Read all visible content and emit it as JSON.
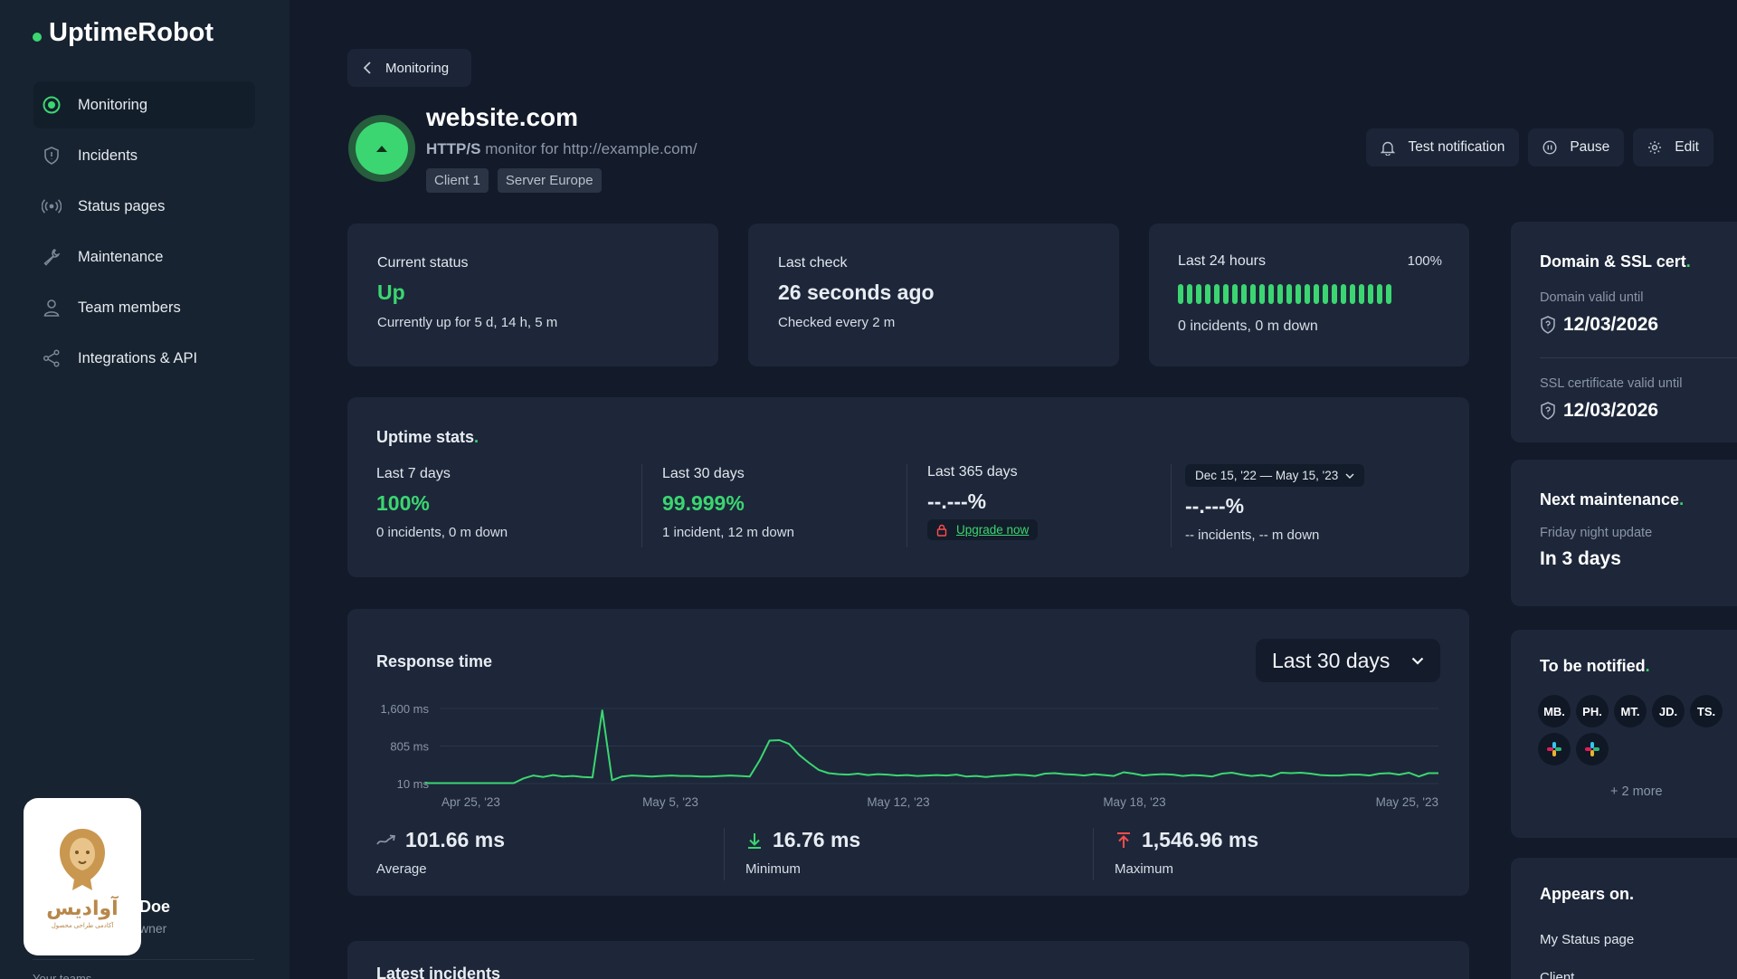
{
  "brand": "UptimeRobot",
  "sidebar": {
    "items": [
      {
        "label": "Monitoring"
      },
      {
        "label": "Incidents"
      },
      {
        "label": "Status pages"
      },
      {
        "label": "Maintenance"
      },
      {
        "label": "Team members"
      },
      {
        "label": "Integrations & API"
      }
    ],
    "user_name": "Doe",
    "user_role": "wner",
    "more": "Your teams",
    "badge_brand": "آوادیس",
    "badge_tag": "آکادمی طراحی محصول"
  },
  "back_label": "Monitoring",
  "monitor": {
    "title": "website.com",
    "type": "HTTP/S",
    "subtitle": "monitor for http://example.com/",
    "tags": [
      "Client 1",
      "Server Europe"
    ]
  },
  "actions": {
    "test": "Test notification",
    "pause": "Pause",
    "edit": "Edit"
  },
  "current_status": {
    "label": "Current status",
    "value": "Up",
    "detail": "Currently up for 5 d, 14 h, 5 m"
  },
  "last_check": {
    "label": "Last check",
    "value": "26 seconds ago",
    "detail": "Checked every 2 m"
  },
  "last24": {
    "label": "Last 24 hours",
    "percent": "100%",
    "detail": "0 incidents, 0 m down",
    "up_fraction": 1.0
  },
  "uptime": {
    "title": "Uptime stats",
    "dot": ".",
    "cols": [
      {
        "label": "Last 7 days",
        "value": "100%",
        "detail": "0 incidents, 0 m down"
      },
      {
        "label": "Last 30 days",
        "value": "99.999%",
        "detail": "1 incident, 12 m down"
      },
      {
        "label": "Last 365 days",
        "value": "--.---%",
        "upgrade": "Upgrade now"
      },
      {
        "range": "Dec 15, '22 — May 15, '23",
        "value": "--.---%",
        "detail": "-- incidents, -- m down"
      }
    ]
  },
  "response": {
    "title": "Response time",
    "period": "Last 30 days",
    "average": "101.66 ms",
    "average_label": "Average",
    "minimum": "16.76 ms",
    "minimum_label": "Minimum",
    "maximum": "1,546.96 ms",
    "maximum_label": "Maximum"
  },
  "chart_data": {
    "type": "line",
    "y_ticks": [
      "1,600 ms",
      "805 ms",
      "10 ms"
    ],
    "x_ticks": [
      "Apr 25, '23",
      "May 5, '23",
      "May 12, '23",
      "May 18, '23",
      "May 25, '23"
    ],
    "ylim": [
      10,
      1600
    ],
    "grid": true,
    "series": [
      {
        "values": [
          20,
          20,
          20,
          20,
          20,
          20,
          20,
          20,
          20,
          20,
          120,
          180,
          150,
          190,
          160,
          170,
          150,
          140,
          1560,
          80,
          160,
          180,
          170,
          160,
          170,
          180,
          170,
          170,
          160,
          160,
          170,
          180,
          170,
          160,
          500,
          920,
          930,
          850,
          620,
          450,
          300,
          230,
          210,
          200,
          220,
          190,
          210,
          200,
          180,
          190,
          170,
          180,
          190,
          180,
          200,
          160,
          170,
          150,
          170,
          180,
          200,
          190,
          170,
          220,
          230,
          210,
          200,
          180,
          210,
          190,
          170,
          250,
          220,
          180,
          200,
          210,
          200,
          170,
          190,
          180,
          160,
          220,
          240,
          200,
          170,
          190,
          160,
          240,
          230,
          240,
          220,
          190,
          180,
          180,
          200,
          200,
          180,
          220,
          230,
          200,
          240,
          160,
          230,
          230
        ]
      }
    ]
  },
  "incidents_title": "Latest incidents",
  "domain": {
    "title": "Domain & SSL cert",
    "domain_label": "Domain valid until",
    "domain_value": "12/03/2026",
    "ssl_label": "SSL certificate valid until",
    "ssl_value": "12/03/2026"
  },
  "maintenance": {
    "title": "Next maintenance",
    "name": "Friday night update",
    "value": "In 3 days"
  },
  "notified": {
    "title": "To be notified",
    "people": [
      "MB.",
      "PH.",
      "MT.",
      "JD.",
      "TS."
    ],
    "more": "+ 2 more"
  },
  "appears": {
    "title": "Appears on",
    "item": "My Status page",
    "next": "Client"
  },
  "colors": {
    "accent": "#3bd671",
    "bg": "#131a2a",
    "card": "#1d2739",
    "sidebar": "#172330",
    "danger": "#ff4d4d"
  }
}
